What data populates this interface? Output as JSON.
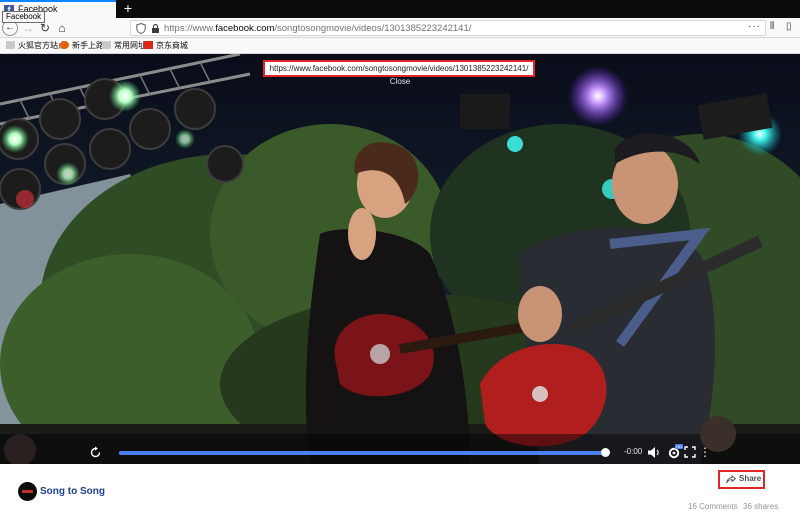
{
  "browser": {
    "tab_title": "Facebook",
    "tab_tooltip": "Facebook",
    "new_tab": "+",
    "url_prefix": "https://www.",
    "url_domain": "facebook.com",
    "url_path": "/songtosongmovie/videos/1301385223242141/",
    "bookmarks": [
      "火狐官方站点",
      "新手上路",
      "常用网址",
      "京东商城"
    ]
  },
  "video": {
    "url_overlay": "https://www.facebook.com/songtosongmovie/videos/1301385223242141/",
    "close_label": "Close",
    "time_remaining": "-0:00",
    "progress": 1.0,
    "hd_badge": "HD"
  },
  "post": {
    "page_name": "Song to Song",
    "share_label": "Share",
    "comments": "16 Comments",
    "shares": "36 shares"
  },
  "colors": {
    "facebook_blue": "#3b5998",
    "progress_blue": "#4a80f5",
    "highlight_red": "#e02626"
  },
  "icons": [
    "back-icon",
    "forward-icon",
    "reload-icon",
    "home-icon",
    "shield-icon",
    "lock-icon",
    "replay-icon",
    "volume-icon",
    "hd-icon",
    "fullscreen-icon",
    "more-icon",
    "share-icon"
  ]
}
